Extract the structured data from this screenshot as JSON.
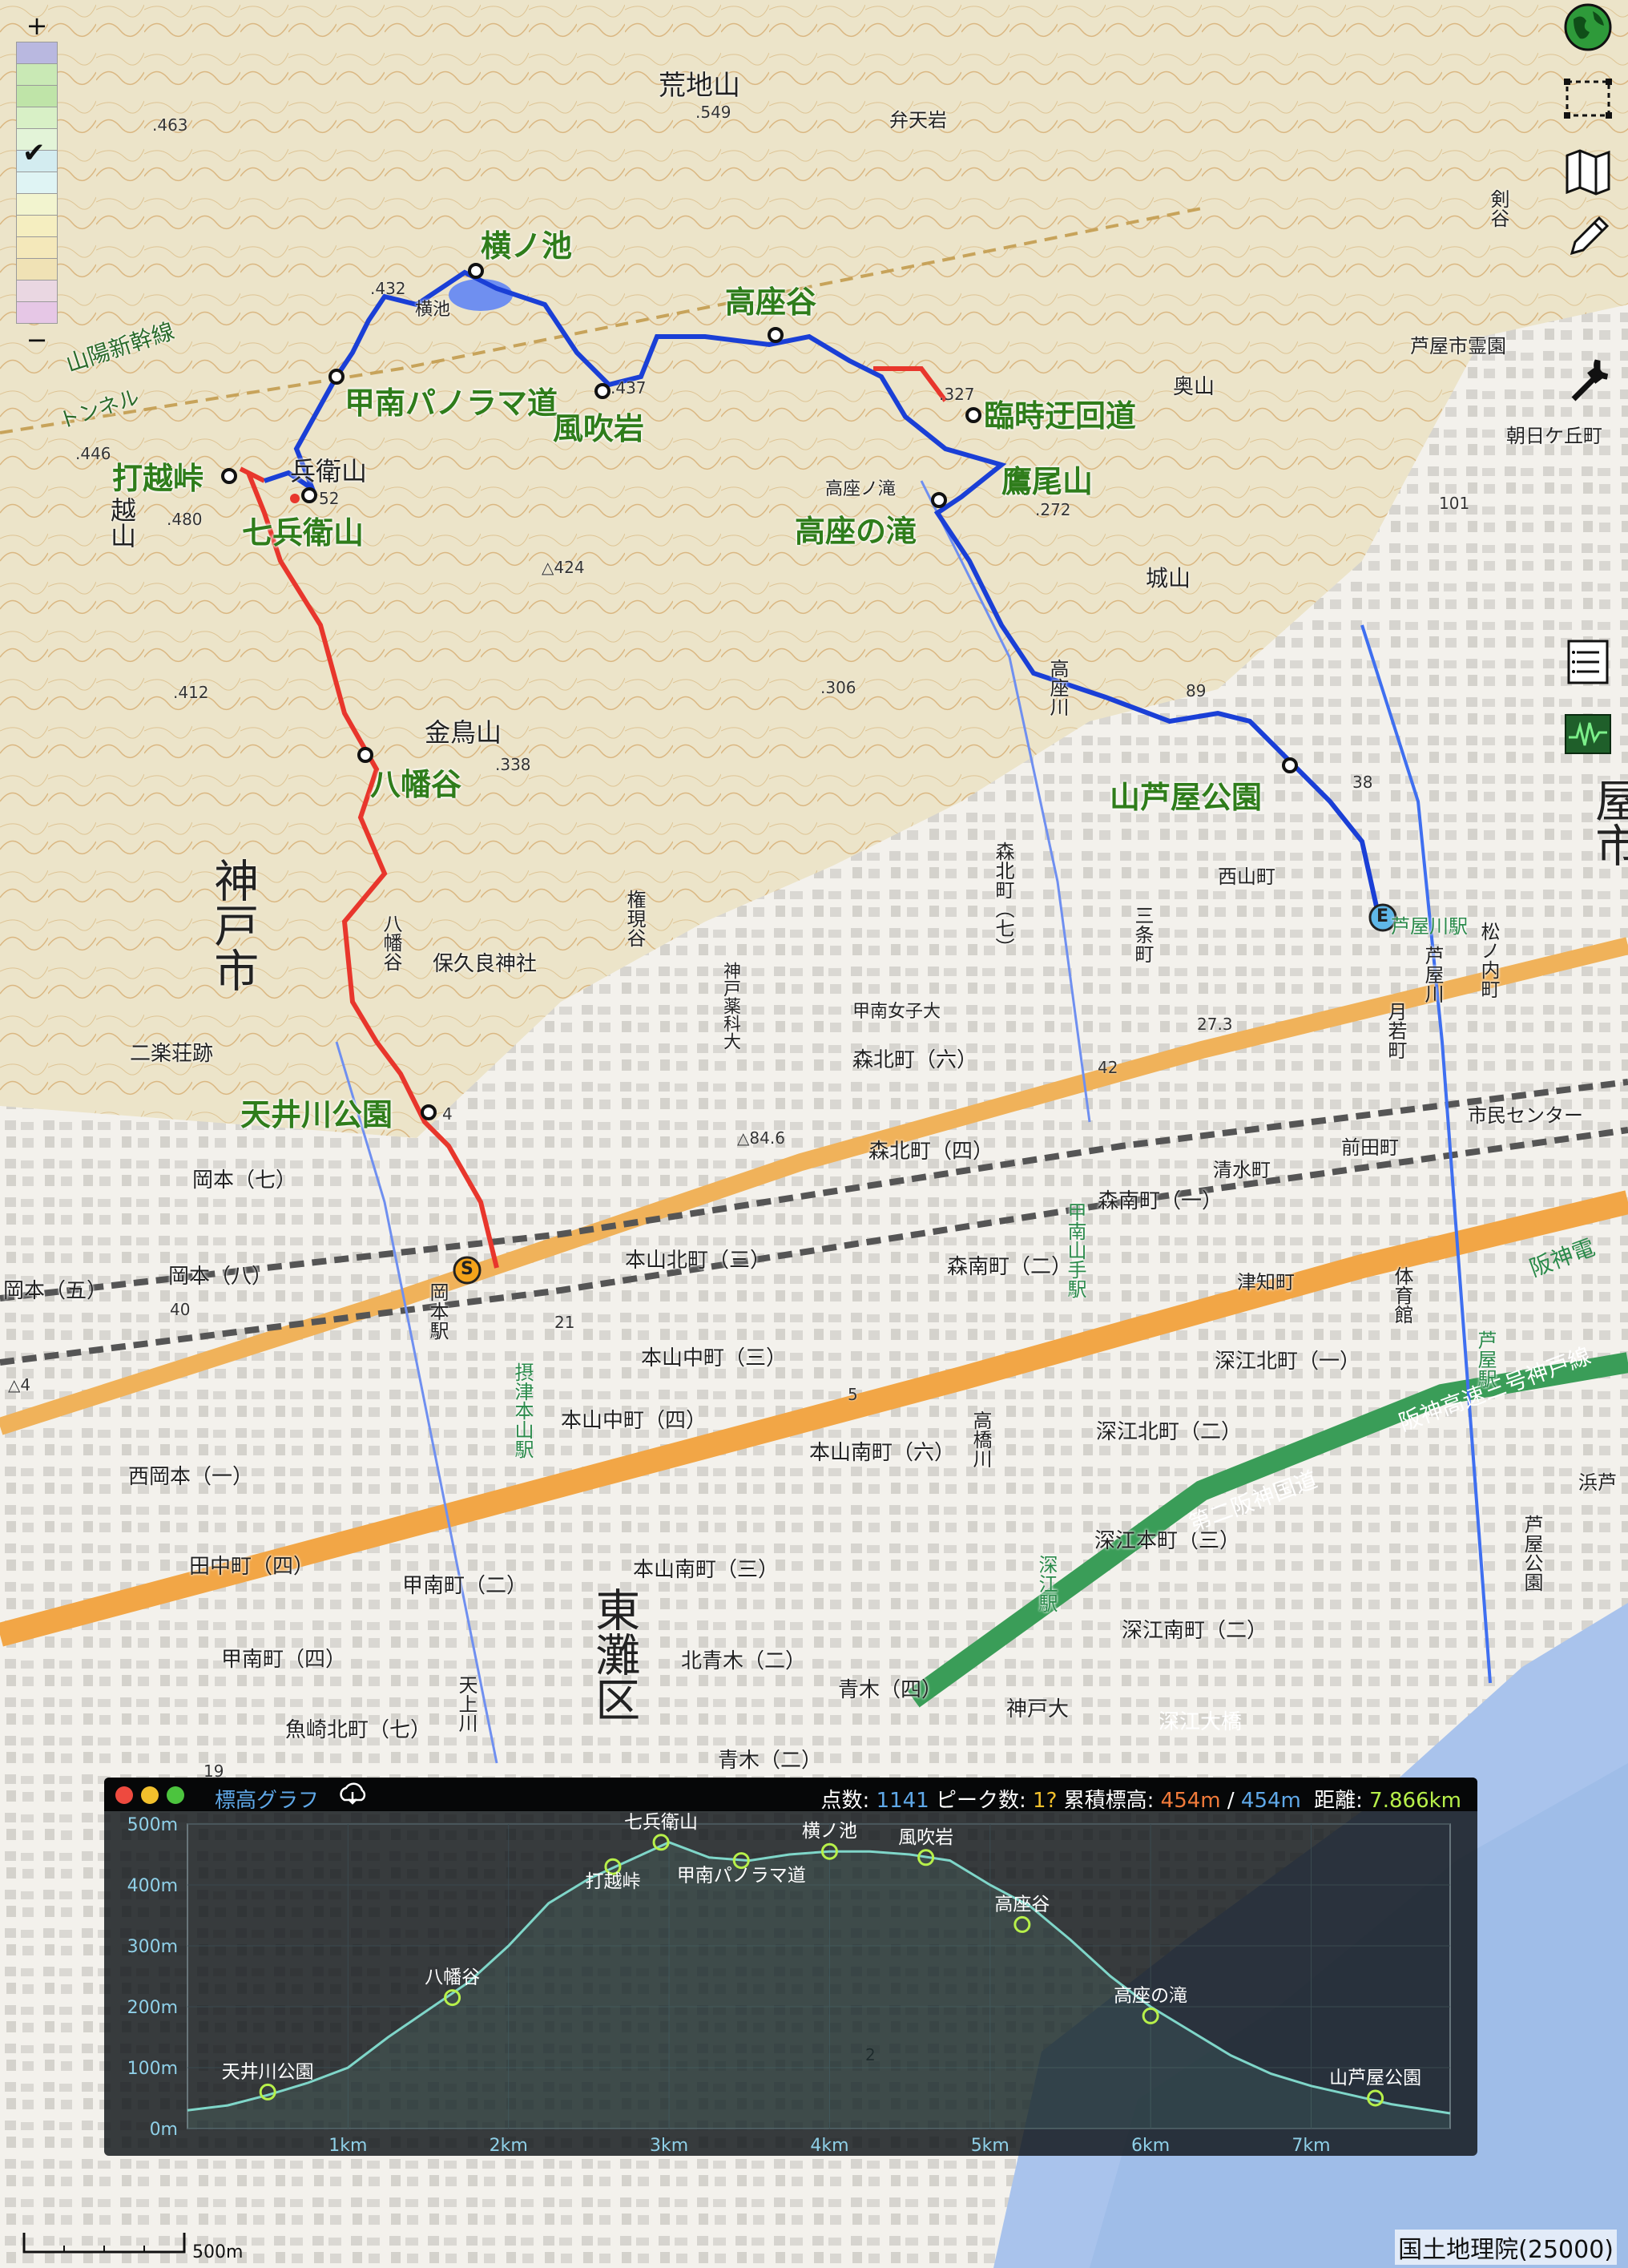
{
  "colors": {
    "route_blue": "#1a3fd6",
    "route_red": "#e8362c",
    "waypoint_text": "#2f7d1b",
    "urban": "#f2f0ea",
    "forest": "#e6dfc6",
    "water": "#3f6ff0",
    "chart_line": "#7fd6c9",
    "chart_marker": "#b7f04a",
    "total_up": "#f07a3a",
    "total_down": "#5fa8e8",
    "distance": "#b7f04a"
  },
  "waypoints": [
    {
      "name": "横ノ池"
    },
    {
      "name": "高座谷"
    },
    {
      "name": "甲南パノラマ道"
    },
    {
      "name": "風吹岩"
    },
    {
      "name": "臨時迂回道"
    },
    {
      "name": "打越峠"
    },
    {
      "name": "七兵衛山"
    },
    {
      "name": "鷹尾山"
    },
    {
      "name": "高座の滝"
    },
    {
      "name": "八幡谷"
    },
    {
      "name": "山芦屋公園"
    },
    {
      "name": "天井川公園"
    }
  ],
  "map_labels": {
    "araji": "荒地山",
    "benten": "弁天岩",
    "yokoike_small": "横池",
    "heiei": "兵衛山",
    "koshi_mt": "越山",
    "kinchou": "金鳥山",
    "kobe_city": "神戸市",
    "higashinada": "東灘区",
    "ashiya_city": "屋市",
    "hachiman_small": "八幡谷",
    "hokura": "保久良神社",
    "gongen": "権現谷",
    "kobe_yakka": "神戸薬科大",
    "konan_joshi": "甲南女子大",
    "morikita_6": "森北町（六）",
    "morikita_4": "森北町（四）",
    "nishiyama": "西山町",
    "shiroyama": "城山",
    "okuyama": "奥山",
    "ashiya_cemetery": "芦屋市霊園",
    "asahigaoka": "朝日ケ丘町",
    "sanyo_shinkansen": "山陽新幹線",
    "tunnel": "トンネル",
    "okamoto_7": "岡本（七）",
    "okamoto_8": "岡本（八）",
    "okamoto_5": "岡本（五）",
    "rakusou": "二楽荘跡",
    "motoyama_kita_3": "本山北町（三）",
    "motoyama_naka_3": "本山中町（三）",
    "motoyama_naka_4": "本山中町（四）",
    "motoyama_minami_6": "本山南町（六）",
    "motoyama_minami_3": "本山南町（三）",
    "morinan_1": "森南町（一）",
    "morinan_2": "森南町（二）",
    "fukae_kita_1": "深江北町（一）",
    "fukae_kita_2": "深江北町（二）",
    "fukae_hon_3": "深江本町（三）",
    "fukae_minami_2": "深江南町（二）",
    "kitaoki_2": "北青木（二）",
    "aogi_4": "青木（四）",
    "aogi_2": "青木（二）",
    "tanaka_4": "田中町（四）",
    "nishiokamoto_1": "西岡本（一）",
    "konan_2": "甲南町（二）",
    "konan_4": "甲南町（四）",
    "uozaki_kita_7": "魚崎北町（七）",
    "kobe_daigaku": "神戸大",
    "fukae_ohashi": "深江大橋",
    "shimin_center": "市民センター",
    "maeda": "前田町",
    "shimizu": "清水町",
    "tsuchi": "津知町",
    "hanshin_kokudo": "第二阪神国道",
    "hanshin_expressway": "阪神高速三号神戸線",
    "hanshin_dentetsu": "阪神電",
    "ashiyagawa_station": "芦屋川駅",
    "okamoto_station": "岡本駅",
    "settsu_motoyama": "摂津本山駅",
    "konan_yamate": "甲南山手駅",
    "fukae_station": "深江駅",
    "ashiya_station2": "芦屋駅",
    "taiikukan": "体育館",
    "takahashi_river": "高橋川",
    "tenjo_river": "天上川",
    "takaza_river": "高座川",
    "ashiya_river": "芦屋川",
    "takaza_falls_small": "高座ノ滝",
    "sanjo_cho": "三条町",
    "morikita_7": "森北町（七）",
    "ashiya_park": "芦屋公園",
    "matsunouchi": "松ノ内町",
    "getsujaku": "月若町",
    "ken": "剣谷",
    "hamaashi": "浜芦"
  },
  "spot_heights": [
    ".463",
    ".549",
    ".432",
    ".437",
    ".327",
    ".272",
    ".480",
    ".446",
    "52",
    "△424",
    ".412",
    ".338",
    ".306",
    "89",
    "38",
    "101",
    "4",
    "△84.6",
    "42",
    "27.3",
    "5",
    "21",
    "19",
    "40",
    "△4",
    "2"
  ],
  "letters": {
    "start": "S",
    "end": "E"
  },
  "controls": {
    "zoom_in": "+",
    "zoom_out": "−",
    "check": "✔"
  },
  "tools": [
    "globe-icon",
    "select-area-icon",
    "map-icon",
    "pencil-icon",
    "wrench-icon",
    "list-icon",
    "elevation-graph-icon"
  ],
  "legend_colors": [
    "#b9b8e0",
    "#c9e9b5",
    "#bfe4a8",
    "#d8f0c6",
    "#e3f4d8",
    "#d3ecf0",
    "#dff4f4",
    "#f2f4cf",
    "#f5eec0",
    "#f4e8ba",
    "#f0e2b5",
    "#ead7e2",
    "#e6c7e6"
  ],
  "elevation_panel": {
    "title": "標高グラフ",
    "points_label": "点数:",
    "points": "1141",
    "peaks_label": "ピーク数:",
    "peaks": "1?",
    "ascent_label": "累積標高:",
    "ascent": "454m",
    "slash": "/",
    "descent": "454m",
    "distance_label": "距離:",
    "distance": "7.866km"
  },
  "chart_data": {
    "type": "area",
    "xlabel": "",
    "ylabel": "",
    "x_ticks": [
      "1km",
      "2km",
      "3km",
      "4km",
      "5km",
      "6km",
      "7km"
    ],
    "y_ticks": [
      "0m",
      "100m",
      "200m",
      "300m",
      "400m",
      "500m"
    ],
    "xlim": [
      0,
      7.866
    ],
    "ylim": [
      0,
      500
    ],
    "series": [
      {
        "x": [
          0,
          0.25,
          0.5,
          0.75,
          1.0,
          1.25,
          1.5,
          1.75,
          2.0,
          2.25,
          2.5,
          2.75,
          3.0,
          3.25,
          3.5,
          3.75,
          4.0,
          4.25,
          4.5,
          4.75,
          5.0,
          5.25,
          5.5,
          5.75,
          6.0,
          6.25,
          6.5,
          6.75,
          7.0,
          7.25,
          7.5,
          7.866
        ],
        "y": [
          30,
          38,
          55,
          75,
          100,
          150,
          195,
          240,
          300,
          370,
          410,
          440,
          470,
          445,
          440,
          450,
          455,
          455,
          450,
          440,
          400,
          365,
          310,
          250,
          200,
          160,
          120,
          90,
          70,
          55,
          40,
          25
        ]
      }
    ],
    "markers": [
      {
        "label": "天井川公園",
        "x": 0.5,
        "y": 60
      },
      {
        "label": "八幡谷",
        "x": 1.65,
        "y": 215
      },
      {
        "label": "打越峠",
        "x": 2.65,
        "y": 430
      },
      {
        "label": "七兵衛山",
        "x": 2.95,
        "y": 470
      },
      {
        "label": "甲南パノラマ道",
        "x": 3.45,
        "y": 440
      },
      {
        "label": "横ノ池",
        "x": 4.0,
        "y": 455
      },
      {
        "label": "風吹岩",
        "x": 4.6,
        "y": 445
      },
      {
        "label": "高座谷",
        "x": 5.2,
        "y": 335
      },
      {
        "label": "高座の滝",
        "x": 6.0,
        "y": 185
      },
      {
        "label": "山芦屋公園",
        "x": 7.4,
        "y": 50
      }
    ]
  },
  "scale_bar": "500m",
  "attribution": "国土地理院(25000)"
}
